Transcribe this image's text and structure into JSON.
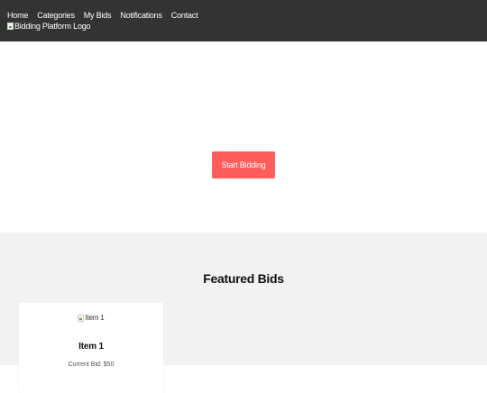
{
  "header": {
    "nav": [
      "Home",
      "Categories",
      "My Bids",
      "Notifications",
      "Contact"
    ],
    "logo_alt": "Bidding Platform Logo"
  },
  "hero": {
    "cta_label": "Start Bidding"
  },
  "featured": {
    "title": "Featured Bids",
    "items": [
      {
        "image_alt": "Item 1",
        "name": "Item 1",
        "bid": "Current Bid: $50"
      }
    ]
  },
  "colors": {
    "header_bg": "#333333",
    "accent": "#ff5c5c",
    "section_bg": "#f2f2f2"
  }
}
